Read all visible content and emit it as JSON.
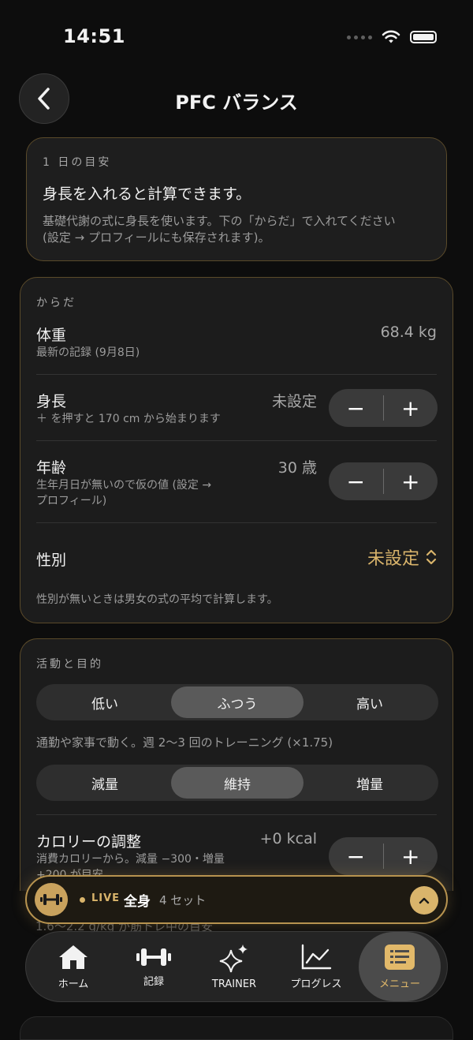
{
  "status_bar": {
    "time": "14:51"
  },
  "header": {
    "title": "PFC バランス"
  },
  "goal_card": {
    "label": "1 日の目安",
    "title": "身長を入れると計算できます。",
    "desc_line1": "基礎代謝の式に身長を使います。下の「からだ」で入れてください",
    "desc_line2": "(設定 → プロフィールにも保存されます)。"
  },
  "body_card": {
    "label": "からだ",
    "weight": {
      "title": "体重",
      "sub": "最新の記録 (9月8日)",
      "value": "68.4 kg"
    },
    "height": {
      "title": "身長",
      "sub": "＋ を押すと 170 cm から始まります",
      "value": "未設定"
    },
    "age": {
      "title": "年齢",
      "sub_line1": "生年月日が無いので仮の値 (設定 →",
      "sub_line2": "プロフィール)",
      "value": "30 歳"
    },
    "sex": {
      "title": "性別",
      "value": "未設定",
      "note": "性別が無いときは男女の式の平均で計算します。"
    },
    "minus": "−",
    "plus": "+"
  },
  "activity_card": {
    "label": "活動と目的",
    "activity_options": [
      "低い",
      "ふつう",
      "高い"
    ],
    "activity_selected": 1,
    "activity_desc": "通勤や家事で動く。週 2〜3 回のトレーニング (×1.75)",
    "goal_options": [
      "減量",
      "維持",
      "増量"
    ],
    "goal_selected": 1,
    "calorie": {
      "title": "カロリーの調整",
      "value": "+0 kcal",
      "sub_line1": "消費カロリーから。減量 −300・増量",
      "sub_line2": "+200 が目安"
    },
    "partial_line": "1.6〜2.2 g/kg が筋トレ中の目安"
  },
  "live": {
    "badge": "LIVE",
    "name": "全身",
    "sets": "4 セット"
  },
  "tabs": [
    {
      "label": "ホーム",
      "icon": "home-icon"
    },
    {
      "label": "記録",
      "icon": "dumbbell-icon"
    },
    {
      "label": "TRAINER",
      "icon": "sparkles-icon"
    },
    {
      "label": "プログレス",
      "icon": "chart-line-icon"
    },
    {
      "label": "メニュー",
      "icon": "menu-list-icon"
    }
  ],
  "colors": {
    "accent": "#d9b46b",
    "background": "#0d0d0d",
    "card": "#1c1c1c"
  }
}
